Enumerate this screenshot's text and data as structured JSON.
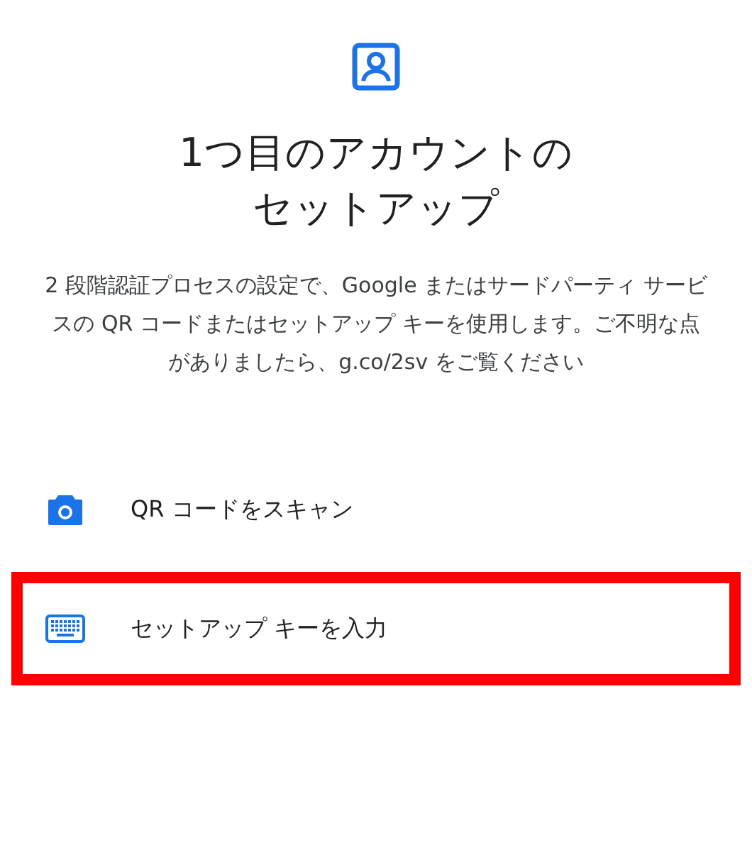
{
  "title_lines": [
    "1つ目のアカウントの",
    "セットアップ"
  ],
  "description": "2 段階認証プロセスの設定で、Google またはサードパーティ サービスの QR コードまたはセットアップ キーを使用します。ご不明な点がありましたら、g.co/2sv をご覧ください",
  "options": [
    {
      "kind": "qr",
      "label": "QR コードをスキャン",
      "highlighted": false
    },
    {
      "kind": "key",
      "label": "セットアップ キーを入力",
      "highlighted": true
    }
  ]
}
